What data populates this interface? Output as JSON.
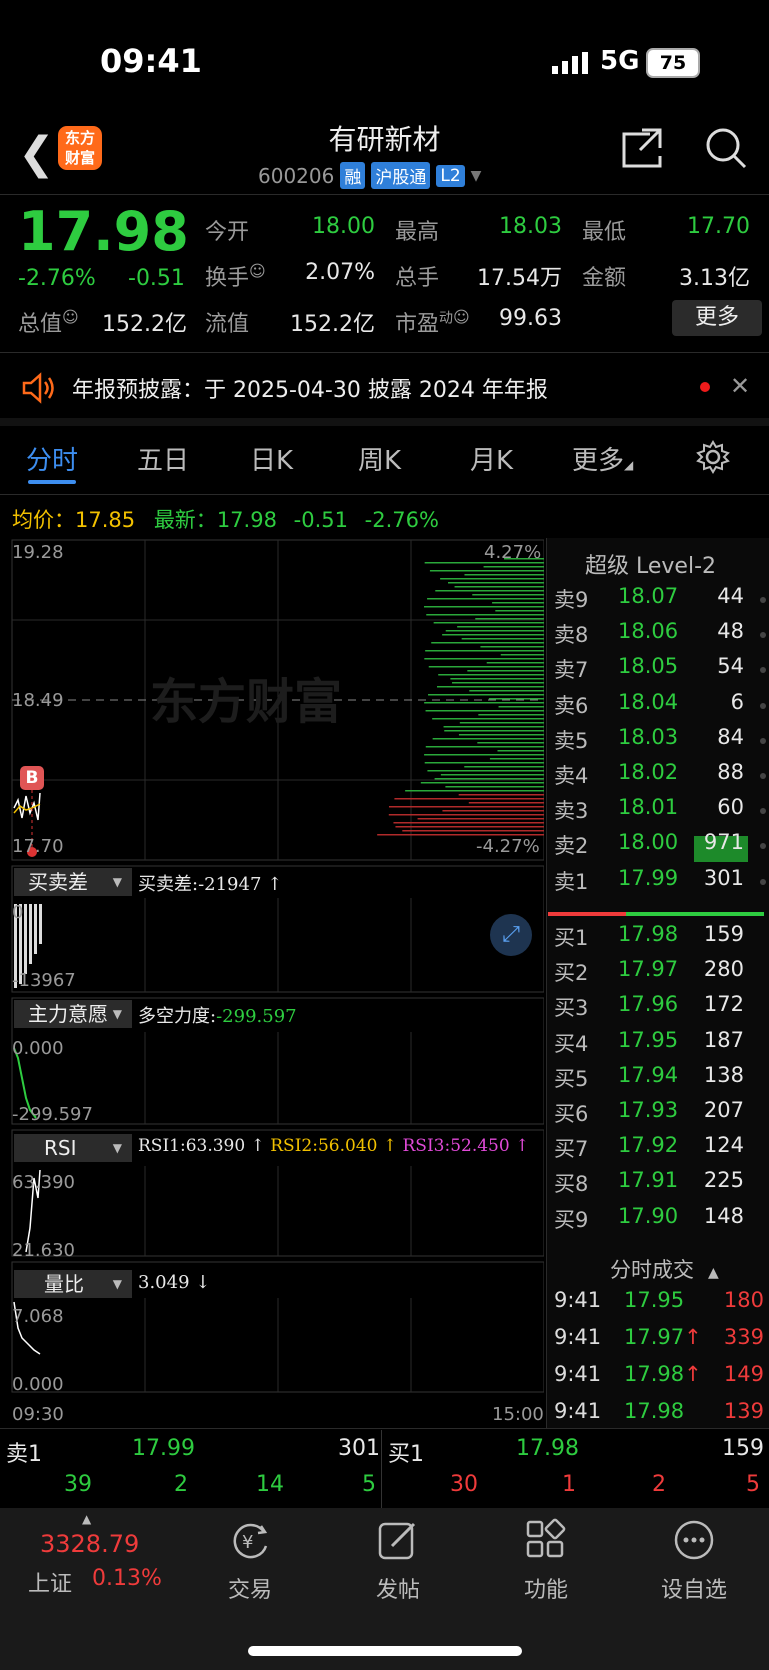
{
  "status": {
    "time": "09:41",
    "network": "5G",
    "battery": "75"
  },
  "header": {
    "title": "有研新材",
    "code": "600206",
    "tags": [
      "融",
      "沪股通",
      "L2"
    ],
    "logo": "东方财富"
  },
  "quote": {
    "price": "17.98",
    "pct": "-2.76%",
    "change": "-0.51",
    "open_label": "今开",
    "open": "18.00",
    "high_label": "最高",
    "high": "18.03",
    "low_label": "最低",
    "low": "17.70",
    "turnover_label": "换手",
    "turnover": "2.07%",
    "volume_label": "总手",
    "volume": "17.54万",
    "amount_label": "金额",
    "amount": "3.13亿",
    "mcap_label": "总值",
    "mcap": "152.2亿",
    "float_label": "流值",
    "float_cap": "152.2亿",
    "pe_label": "市盈",
    "pe_sup": "动",
    "pe": "99.63",
    "more": "更多"
  },
  "notice": {
    "text": "年报预披露：于 2025-04-30 披露 2024 年年报"
  },
  "tabs": [
    "分时",
    "五日",
    "日K",
    "周K",
    "月K",
    "更多"
  ],
  "info": {
    "avg_label": "均价：",
    "avg": "17.85",
    "latest_label": "最新：",
    "latest": "17.98",
    "change": "-0.51",
    "pct": "-2.76%"
  },
  "chart": {
    "y_top": "19.28",
    "y_mid": "18.49",
    "y_bottom": "17.70",
    "pct_top": "4.27%",
    "pct_bottom": "-4.27%",
    "marker": "B",
    "watermark": "东方财富",
    "time_start": "09:30",
    "time_end": "15:00"
  },
  "panels": {
    "p1": {
      "label": "买卖差",
      "value": "买卖差:-21947 ↑",
      "top": "0",
      "bottom": "-13967"
    },
    "p2": {
      "label": "主力意愿",
      "value_label": "多空力度:",
      "value": "-299.597",
      "top": "0.000",
      "bottom": "-299.597"
    },
    "p3": {
      "label": "RSI",
      "rsi1": "RSI1:63.390 ↑",
      "rsi2": "RSI2:56.040 ↑",
      "rsi3": "RSI3:52.450 ↑",
      "top": "63.390",
      "bottom": "21.630"
    },
    "p4": {
      "label": "量比",
      "value": "3.049 ↓",
      "top": "7.068",
      "bottom": "0.000"
    }
  },
  "orderbook": {
    "title": "超级 Level-2",
    "asks": [
      {
        "label": "卖9",
        "price": "18.07",
        "vol": "44"
      },
      {
        "label": "卖8",
        "price": "18.06",
        "vol": "48"
      },
      {
        "label": "卖7",
        "price": "18.05",
        "vol": "54"
      },
      {
        "label": "卖6",
        "price": "18.04",
        "vol": "6"
      },
      {
        "label": "卖5",
        "price": "18.03",
        "vol": "84"
      },
      {
        "label": "卖4",
        "price": "18.02",
        "vol": "88"
      },
      {
        "label": "卖3",
        "price": "18.01",
        "vol": "60"
      },
      {
        "label": "卖2",
        "price": "18.00",
        "vol": "971"
      },
      {
        "label": "卖1",
        "price": "17.99",
        "vol": "301"
      }
    ],
    "bids": [
      {
        "label": "买1",
        "price": "17.98",
        "vol": "159"
      },
      {
        "label": "买2",
        "price": "17.97",
        "vol": "280"
      },
      {
        "label": "买3",
        "price": "17.96",
        "vol": "172"
      },
      {
        "label": "买4",
        "price": "17.95",
        "vol": "187"
      },
      {
        "label": "买5",
        "price": "17.94",
        "vol": "138"
      },
      {
        "label": "买6",
        "price": "17.93",
        "vol": "207"
      },
      {
        "label": "买7",
        "price": "17.92",
        "vol": "124"
      },
      {
        "label": "买8",
        "price": "17.91",
        "vol": "225"
      },
      {
        "label": "买9",
        "price": "17.90",
        "vol": "148"
      }
    ],
    "ticks_title": "分时成交",
    "ticks": [
      {
        "time": "9:41",
        "price": "17.95",
        "vol": "180"
      },
      {
        "time": "9:41",
        "price": "17.97↑",
        "vol": "339"
      },
      {
        "time": "9:41",
        "price": "17.98↑",
        "vol": "149"
      },
      {
        "time": "9:41",
        "price": "17.98",
        "vol": "139"
      }
    ]
  },
  "mini": {
    "ask_label": "卖1",
    "ask_price": "17.99",
    "ask_vol": "301",
    "bid_label": "买1",
    "bid_price": "17.98",
    "bid_vol": "159",
    "ask_queue": [
      "39",
      "2",
      "14",
      "5"
    ],
    "bid_queue": [
      "30",
      "1",
      "2",
      "5"
    ]
  },
  "nav": {
    "index_value": "3328.79",
    "index_name": "上证",
    "index_pct": "0.13%",
    "items": [
      "交易",
      "发帖",
      "功能",
      "设自选"
    ]
  }
}
